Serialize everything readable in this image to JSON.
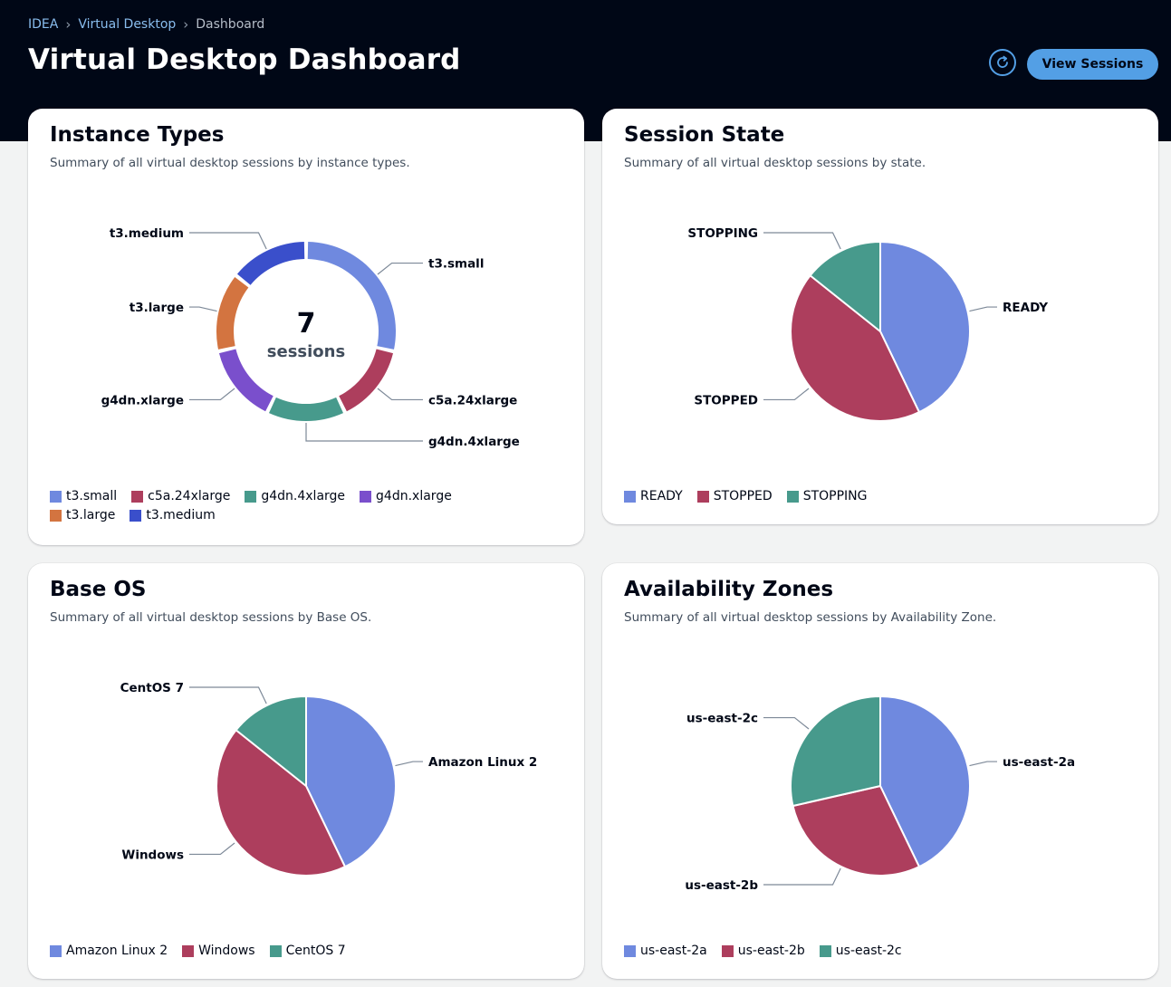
{
  "breadcrumb": {
    "item1": "IDEA",
    "item2": "Virtual Desktop",
    "item3": "Dashboard"
  },
  "header": {
    "title": "Virtual Desktop Dashboard",
    "refresh_icon": "refresh-icon",
    "view_sessions_label": "View Sessions"
  },
  "colors": {
    "header_bg": "#000716",
    "accent": "#539fe5",
    "blue": "#6f89df",
    "red": "#ad3e5d",
    "teal": "#479a8c",
    "purple": "#7a4fcc",
    "orange": "#d37440",
    "darkblue": "#3a4fcb"
  },
  "cards": {
    "instance_types": {
      "title": "Instance Types",
      "description": "Summary of all virtual desktop sessions by instance types.",
      "center_value": "7",
      "center_label": "sessions"
    },
    "session_state": {
      "title": "Session State",
      "description": "Summary of all virtual desktop sessions by state."
    },
    "base_os": {
      "title": "Base OS",
      "description": "Summary of all virtual desktop sessions by Base OS."
    },
    "availability_zones": {
      "title": "Availability Zones",
      "description": "Summary of all virtual desktop sessions by Availability Zone."
    }
  },
  "chart_data": [
    {
      "type": "pie",
      "donut": true,
      "categories": [
        "t3.small",
        "c5a.24xlarge",
        "g4dn.4xlarge",
        "g4dn.xlarge",
        "t3.large",
        "t3.medium"
      ],
      "values": [
        2,
        1,
        1,
        1,
        1,
        1
      ],
      "colors": [
        "#6f89df",
        "#ad3e5d",
        "#479a8c",
        "#7a4fcc",
        "#d37440",
        "#3a4fcb"
      ],
      "legend": "bottom"
    },
    {
      "type": "pie",
      "categories": [
        "READY",
        "STOPPED",
        "STOPPING"
      ],
      "values": [
        3,
        3,
        1
      ],
      "colors": [
        "#6f89df",
        "#ad3e5d",
        "#479a8c"
      ],
      "legend": "bottom"
    },
    {
      "type": "pie",
      "categories": [
        "Amazon Linux 2",
        "Windows",
        "CentOS 7"
      ],
      "values": [
        3,
        3,
        1
      ],
      "colors": [
        "#6f89df",
        "#ad3e5d",
        "#479a8c"
      ],
      "legend": "bottom"
    },
    {
      "type": "pie",
      "categories": [
        "us-east-2a",
        "us-east-2b",
        "us-east-2c"
      ],
      "values": [
        3,
        2,
        2
      ],
      "colors": [
        "#6f89df",
        "#ad3e5d",
        "#479a8c"
      ],
      "legend": "bottom"
    }
  ]
}
